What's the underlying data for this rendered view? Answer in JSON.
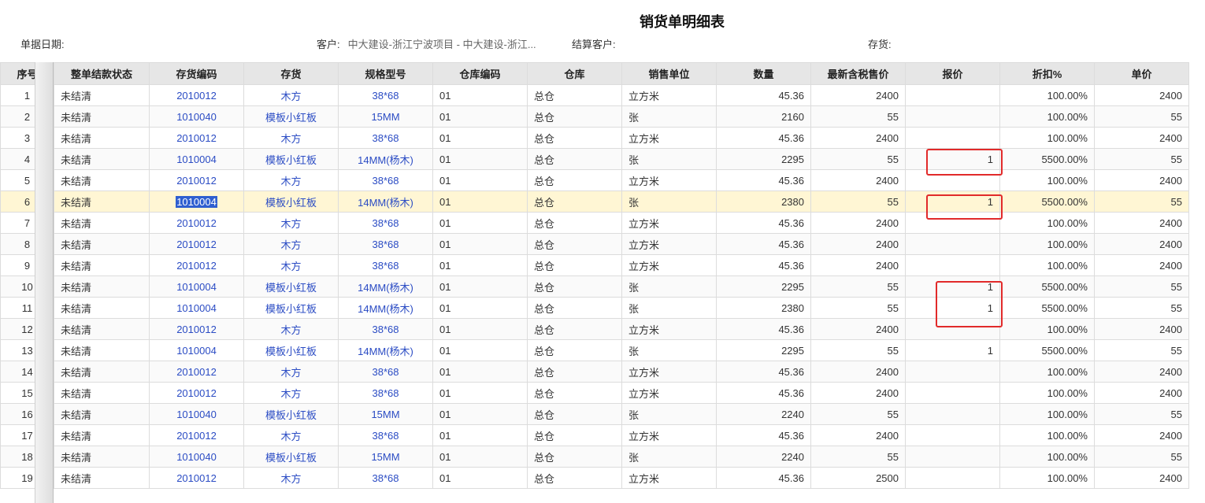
{
  "report": {
    "title": "销货单明细表"
  },
  "filters": {
    "date_label": "单据日期:",
    "customer_label": "客户:",
    "customer_value": "中大建设-浙江宁波项目 - 中大建设-浙江...",
    "settle_customer_label": "结算客户:",
    "inventory_label": "存货:"
  },
  "columns": [
    "序号",
    "整单结款状态",
    "存货编码",
    "存货",
    "规格型号",
    "仓库编码",
    "仓库",
    "销售单位",
    "数量",
    "最新含税售价",
    "报价",
    "折扣%",
    "单价"
  ],
  "rows": [
    [
      "1",
      "未结清",
      "2010012",
      "木方",
      "38*68",
      "01",
      "总仓",
      "立方米",
      "45.36",
      "2400",
      "",
      "100.00%",
      "2400"
    ],
    [
      "2",
      "未结清",
      "1010040",
      "模板小红板",
      "15MM",
      "01",
      "总仓",
      "张",
      "2160",
      "55",
      "",
      "100.00%",
      "55"
    ],
    [
      "3",
      "未结清",
      "2010012",
      "木方",
      "38*68",
      "01",
      "总仓",
      "立方米",
      "45.36",
      "2400",
      "",
      "100.00%",
      "2400"
    ],
    [
      "4",
      "未结清",
      "1010004",
      "模板小红板",
      "14MM(杨木)",
      "01",
      "总仓",
      "张",
      "2295",
      "55",
      "1",
      "5500.00%",
      "55"
    ],
    [
      "5",
      "未结清",
      "2010012",
      "木方",
      "38*68",
      "01",
      "总仓",
      "立方米",
      "45.36",
      "2400",
      "",
      "100.00%",
      "2400"
    ],
    [
      "6",
      "未结清",
      "1010004",
      "模板小红板",
      "14MM(杨木)",
      "01",
      "总仓",
      "张",
      "2380",
      "55",
      "1",
      "5500.00%",
      "55"
    ],
    [
      "7",
      "未结清",
      "2010012",
      "木方",
      "38*68",
      "01",
      "总仓",
      "立方米",
      "45.36",
      "2400",
      "",
      "100.00%",
      "2400"
    ],
    [
      "8",
      "未结清",
      "2010012",
      "木方",
      "38*68",
      "01",
      "总仓",
      "立方米",
      "45.36",
      "2400",
      "",
      "100.00%",
      "2400"
    ],
    [
      "9",
      "未结清",
      "2010012",
      "木方",
      "38*68",
      "01",
      "总仓",
      "立方米",
      "45.36",
      "2400",
      "",
      "100.00%",
      "2400"
    ],
    [
      "10",
      "未结清",
      "1010004",
      "模板小红板",
      "14MM(杨木)",
      "01",
      "总仓",
      "张",
      "2295",
      "55",
      "1",
      "5500.00%",
      "55"
    ],
    [
      "11",
      "未结清",
      "1010004",
      "模板小红板",
      "14MM(杨木)",
      "01",
      "总仓",
      "张",
      "2380",
      "55",
      "1",
      "5500.00%",
      "55"
    ],
    [
      "12",
      "未结清",
      "2010012",
      "木方",
      "38*68",
      "01",
      "总仓",
      "立方米",
      "45.36",
      "2400",
      "",
      "100.00%",
      "2400"
    ],
    [
      "13",
      "未结清",
      "1010004",
      "模板小红板",
      "14MM(杨木)",
      "01",
      "总仓",
      "张",
      "2295",
      "55",
      "1",
      "5500.00%",
      "55"
    ],
    [
      "14",
      "未结清",
      "2010012",
      "木方",
      "38*68",
      "01",
      "总仓",
      "立方米",
      "45.36",
      "2400",
      "",
      "100.00%",
      "2400"
    ],
    [
      "15",
      "未结清",
      "2010012",
      "木方",
      "38*68",
      "01",
      "总仓",
      "立方米",
      "45.36",
      "2400",
      "",
      "100.00%",
      "2400"
    ],
    [
      "16",
      "未结清",
      "1010040",
      "模板小红板",
      "15MM",
      "01",
      "总仓",
      "张",
      "2240",
      "55",
      "",
      "100.00%",
      "55"
    ],
    [
      "17",
      "未结清",
      "2010012",
      "木方",
      "38*68",
      "01",
      "总仓",
      "立方米",
      "45.36",
      "2400",
      "",
      "100.00%",
      "2400"
    ],
    [
      "18",
      "未结清",
      "1010040",
      "模板小红板",
      "15MM",
      "01",
      "总仓",
      "张",
      "2240",
      "55",
      "",
      "100.00%",
      "55"
    ],
    [
      "19",
      "未结清",
      "2010012",
      "木方",
      "38*68",
      "01",
      "总仓",
      "立方米",
      "45.36",
      "2500",
      "",
      "100.00%",
      "2400"
    ]
  ],
  "highlighted_row": "6",
  "selected_cell_text": "1010004",
  "colors": {
    "link": "#2b4cc4",
    "highlight_row": "#fff6d4",
    "annotation": "#e12a2a",
    "selection": "#2f5fd0"
  }
}
